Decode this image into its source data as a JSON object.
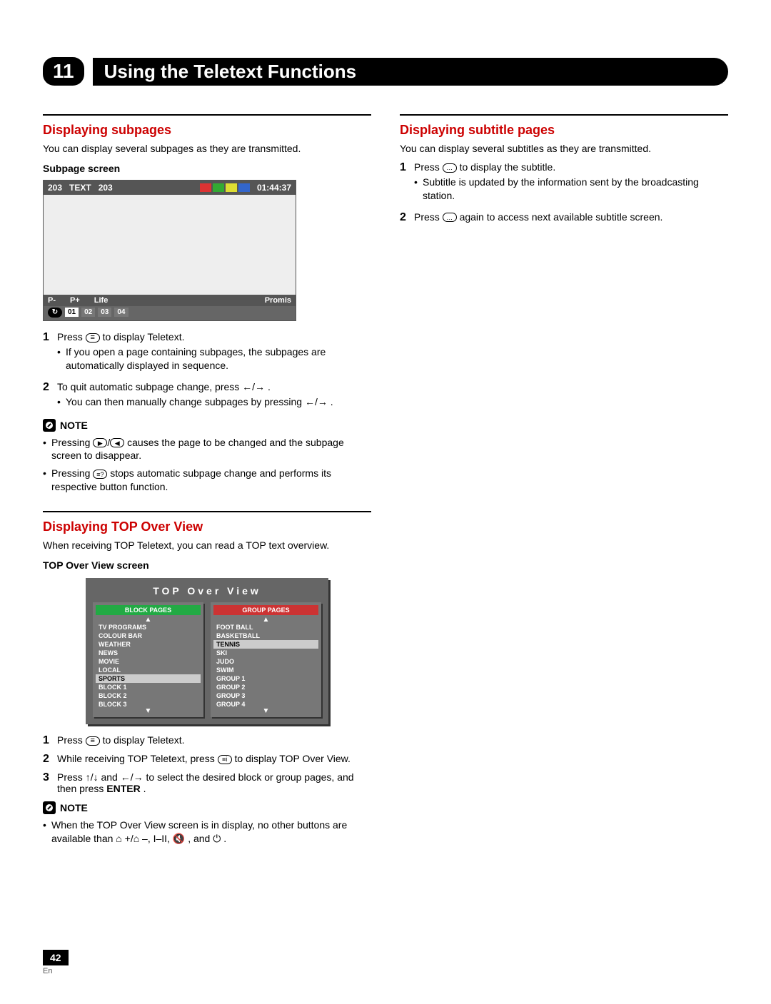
{
  "chapter": {
    "number": "11",
    "title": "Using the Teletext Functions"
  },
  "left": {
    "sec1": {
      "heading": "Displaying subpages",
      "intro": "You can display several subpages as they are transmitted.",
      "sub_screen_label": "Subpage screen",
      "mock": {
        "pg_left": "203",
        "text": "TEXT",
        "pg_mid": "203",
        "time": "01:44:37",
        "pminus": "P-",
        "pplus": "P+",
        "life": "Life",
        "promis": "Promis",
        "p01": "01",
        "p02": "02",
        "p03": "03",
        "p04": "04"
      },
      "step1_num": "1",
      "step1_a": "Press ",
      "step1_b": " to display Teletext.",
      "step1_sub": "If you open a page containing subpages, the subpages are automatically displayed in sequence.",
      "step2_num": "2",
      "step2_a": "To quit automatic subpage change, press ",
      "step2_arrows": "←/→",
      "step2_b": ".",
      "step2_sub_a": "You can then manually change subpages by pressing ",
      "step2_sub_b": "←/→",
      "step2_sub_c": ".",
      "note_label": "NOTE",
      "note1_a": "Pressing ",
      "note1_b": " causes the page to be changed and the subpage screen to disappear.",
      "note2_a": "Pressing ",
      "note2_b": " stops automatic subpage change and performs its respective button function."
    },
    "sec2": {
      "heading": "Displaying TOP Over View",
      "intro": "When receiving TOP Teletext, you can read a TOP text overview.",
      "screen_label": "TOP Over View screen",
      "mock_title": "TOP Over View",
      "block_h": "BLOCK PAGES",
      "group_h": "GROUP PAGES",
      "block_items": [
        "TV PROGRAMS",
        "COLOUR BAR",
        "WEATHER",
        "NEWS",
        "MOVIE",
        "LOCAL",
        "SPORTS",
        "BLOCK 1",
        "BLOCK 2",
        "BLOCK 3"
      ],
      "block_hl_index": 6,
      "group_items": [
        "FOOT BALL",
        "BASKETBALL",
        "TENNIS",
        "SKI",
        "JUDO",
        "SWIM",
        "GROUP 1",
        "GROUP 2",
        "GROUP 3",
        "GROUP 4"
      ],
      "group_hl_index": 2,
      "step1_num": "1",
      "step1_a": "Press ",
      "step1_b": " to display Teletext.",
      "step2_num": "2",
      "step2_a": "While receiving TOP Teletext, press ",
      "step2_b": " to display TOP Over View.",
      "step3_num": "3",
      "step3_a": "Press ",
      "step3_arrows1": "↑/↓",
      "step3_mid": " and ",
      "step3_arrows2": "←/→",
      "step3_b": " to select the desired block or group pages, and then press ",
      "step3_enter": "ENTER",
      "step3_c": ".",
      "note_label": "NOTE",
      "note1_a": "When the TOP Over View screen is in display, no other buttons are available than ",
      "note1_icons": "⌂ +/⌂ –, I–II, 🔇",
      "note1_b": ", and ",
      "note1_power": "⏻",
      "note1_c": "."
    }
  },
  "right": {
    "heading": "Displaying subtitle pages",
    "intro": "You can display several subtitles as they are transmitted.",
    "step1_num": "1",
    "step1_a": "Press ",
    "step1_b": " to display the subtitle.",
    "step1_sub": "Subtitle is updated by the information sent by the broadcasting station.",
    "step2_num": "2",
    "step2_a": "Press ",
    "step2_b": " again to access next available subtitle screen."
  },
  "footer": {
    "page": "42",
    "lang": "En"
  }
}
